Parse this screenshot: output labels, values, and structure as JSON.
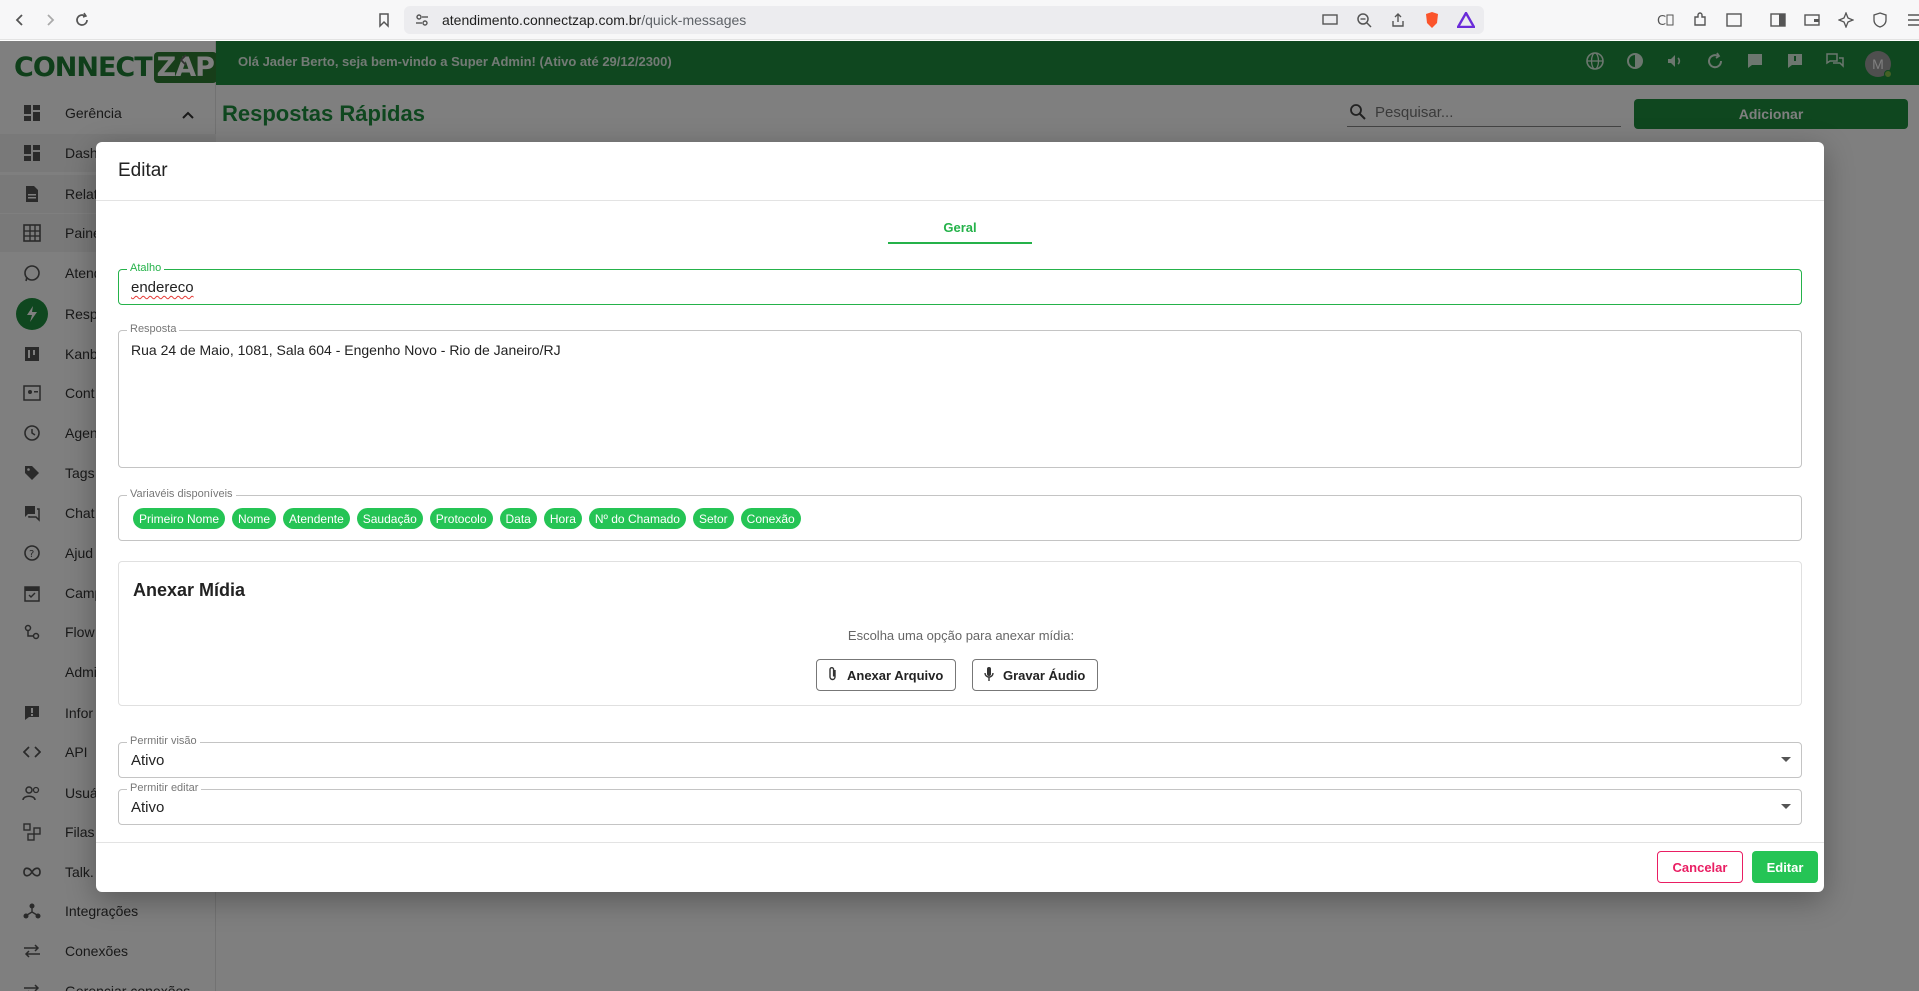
{
  "browser": {
    "url_host": "atendimento.connectzap.com.br",
    "url_path": "/quick-messages"
  },
  "app": {
    "logo_main": "CONNECT",
    "logo_accent": "ZAP",
    "welcome": "Olá Jader Berto, seja bem-vindo a Super Admin! (Ativo até 29/12/2300)",
    "avatar_letter": "M",
    "page_title": "Respostas Rápidas",
    "search_placeholder": "Pesquisar...",
    "add_label": "Adicionar",
    "accent": "#1e8e3e"
  },
  "sidebar": {
    "items": [
      {
        "label": "Gerência",
        "icon": "dashboard-icon"
      },
      {
        "label": "Dash",
        "icon": "dashboard-icon"
      },
      {
        "label": "Relat",
        "icon": "report-icon"
      },
      {
        "label": "Paine",
        "icon": "grid-icon"
      },
      {
        "label": "Atend",
        "icon": "whatsapp-icon"
      },
      {
        "label": "Resp",
        "icon": "bolt-icon"
      },
      {
        "label": "Kanb",
        "icon": "kanban-icon"
      },
      {
        "label": "Cont",
        "icon": "contacts-icon"
      },
      {
        "label": "Agen",
        "icon": "clock-icon"
      },
      {
        "label": "Tags",
        "icon": "tag-icon"
      },
      {
        "label": "Chat",
        "icon": "chat-icon"
      },
      {
        "label": "Ajud",
        "icon": "help-icon"
      },
      {
        "label": "Camp",
        "icon": "calendar-icon"
      },
      {
        "label": "Flow",
        "icon": "flow-icon"
      },
      {
        "label": "Admi",
        "icon": ""
      },
      {
        "label": "Infor",
        "icon": "info-icon"
      },
      {
        "label": "API",
        "icon": "code-icon"
      },
      {
        "label": "Usuá",
        "icon": "users-icon"
      },
      {
        "label": "Filas",
        "icon": "queue-icon"
      },
      {
        "label": "Talk.",
        "icon": "infinity-icon"
      },
      {
        "label": "Integrações",
        "icon": "integration-icon"
      },
      {
        "label": "Conexões",
        "icon": "swap-icon"
      },
      {
        "label": "Gerenciar conexões",
        "icon": "swap-icon"
      }
    ]
  },
  "modal": {
    "title": "Editar",
    "tab": "Geral",
    "shortcut": {
      "label": "Atalho",
      "value": "endereco"
    },
    "response": {
      "label": "Resposta",
      "value": "Rua 24 de Maio, 1081, Sala 604 - Engenho Novo - Rio de Janeiro/RJ"
    },
    "variables": {
      "label": "Variavéis disponíveis",
      "chips": [
        "Primeiro Nome",
        "Nome",
        "Atendente",
        "Saudação",
        "Protocolo",
        "Data",
        "Hora",
        "Nº do Chamado",
        "Setor",
        "Conexão"
      ]
    },
    "media": {
      "title": "Anexar Mídia",
      "hint": "Escolha uma opção para anexar mídia:",
      "attach_label": "Anexar Arquivo",
      "record_label": "Gravar Áudio"
    },
    "allow_view": {
      "label": "Permitir visão",
      "value": "Ativo"
    },
    "allow_edit": {
      "label": "Permitir editar",
      "value": "Ativo"
    },
    "cancel_label": "Cancelar",
    "edit_label": "Editar"
  }
}
